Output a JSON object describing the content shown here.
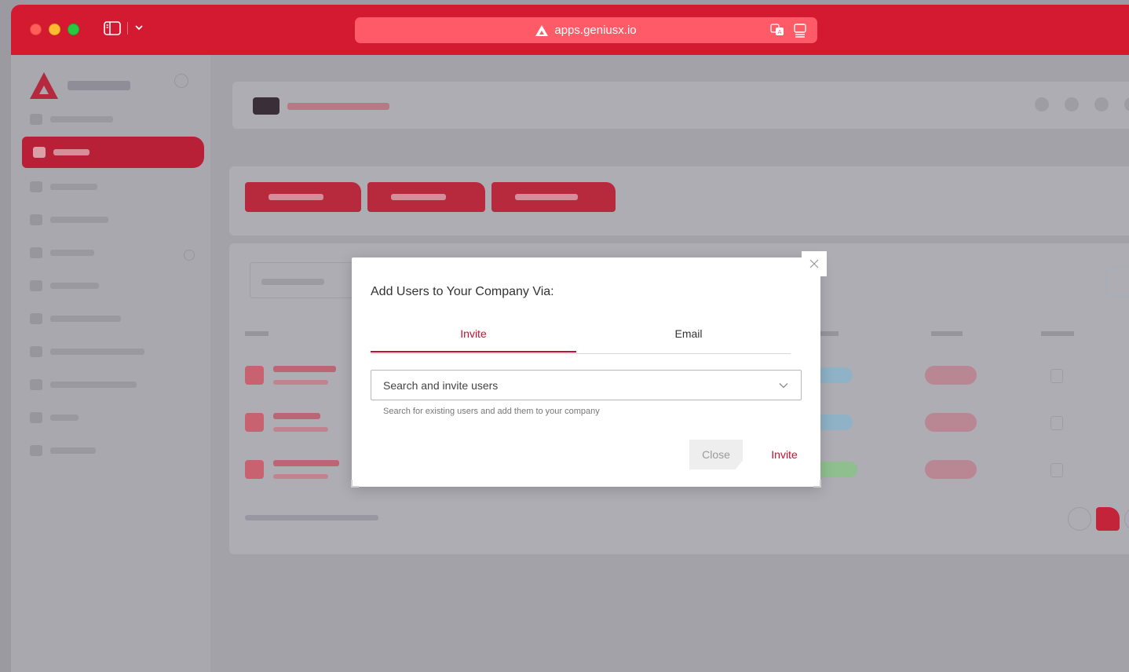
{
  "browser": {
    "url": "apps.geniusx.io"
  },
  "modal": {
    "title": "Add Users to Your Company Via:",
    "tabs": [
      {
        "label": "Invite",
        "active": true
      },
      {
        "label": "Email",
        "active": false
      }
    ],
    "select": {
      "placeholder": "Search and invite users",
      "hint": "Search for existing users and add them to your company"
    },
    "buttons": {
      "close": "Close",
      "invite": "Invite"
    }
  },
  "colors": {
    "titlebar": "#d31a30",
    "accent": "#c8102e",
    "urlbar": "#fe5a67"
  },
  "icons": {
    "close": "close-icon",
    "dropdown": "chevron-down-icon"
  }
}
